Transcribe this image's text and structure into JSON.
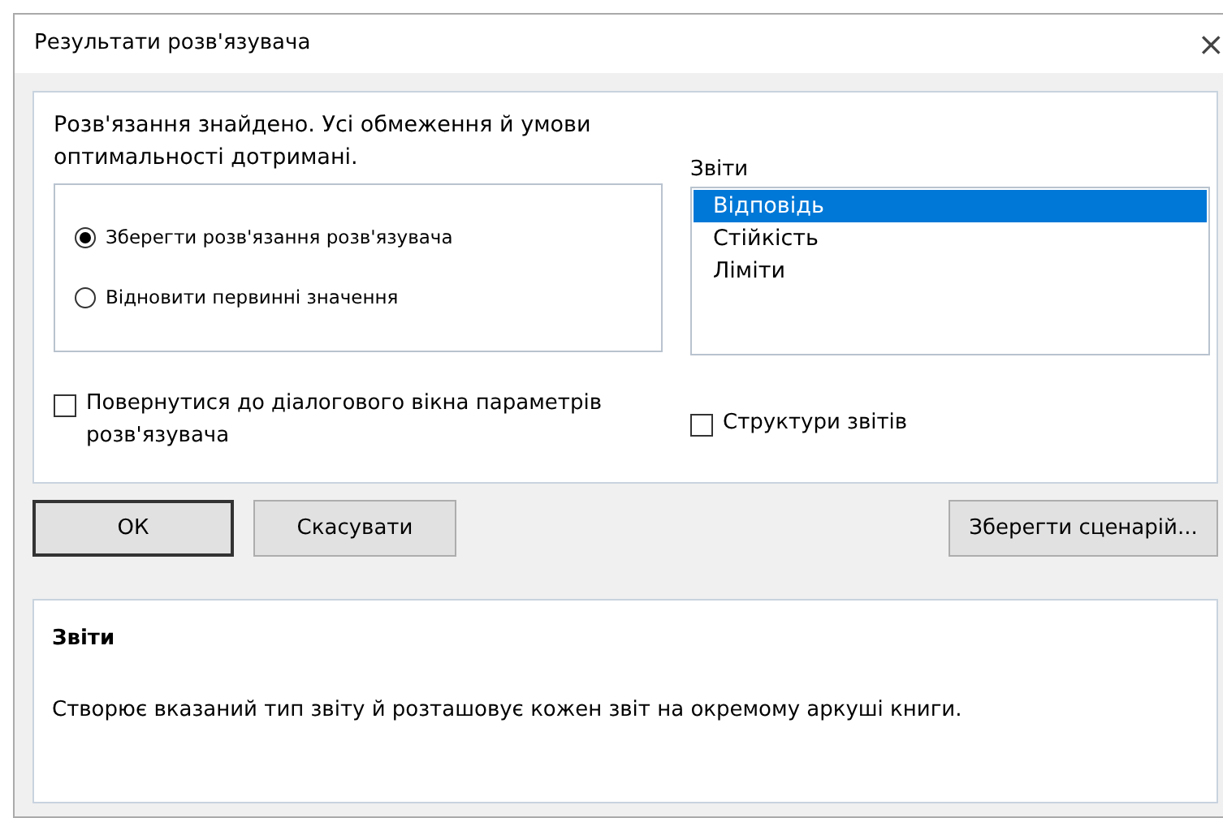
{
  "window": {
    "title": "Результати розв'язувача",
    "close": "×"
  },
  "message": "Розв'язання знайдено. Усі обмеження й умови оптимальності дотримані.",
  "options": [
    {
      "label": "Зберегти розв'язання розв'язувача",
      "selected": true
    },
    {
      "label": "Відновити первинні значення",
      "selected": false
    }
  ],
  "reports": {
    "label": "Звіти",
    "items": [
      {
        "label": "Відповідь",
        "selected": true
      },
      {
        "label": "Стійкість",
        "selected": false
      },
      {
        "label": "Ліміти",
        "selected": false
      }
    ]
  },
  "checkboxes": [
    {
      "label": "Повернутися до діалогового вікна параметрів розв'язувача",
      "checked": false
    },
    {
      "label": "Структури звітів",
      "checked": false
    }
  ],
  "buttons": [
    {
      "label": "ОК",
      "default": true
    },
    {
      "label": "Скасувати",
      "default": false
    },
    {
      "label": "Зберегти сценарій...",
      "default": false
    }
  ],
  "description": {
    "title": "Звіти",
    "text": "Створює вказаний тип звіту й розташовує кожен звіт на окремому аркуші книги."
  }
}
